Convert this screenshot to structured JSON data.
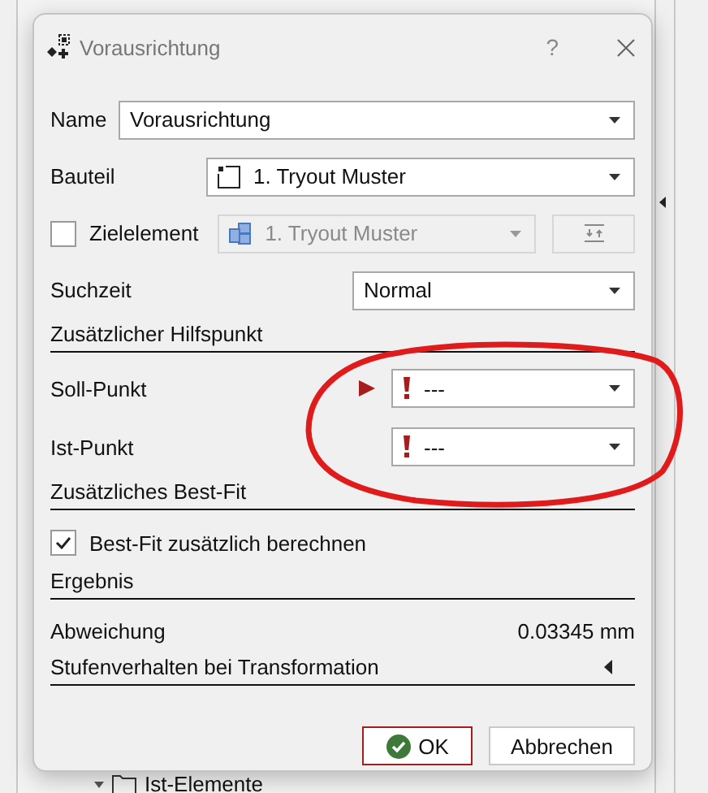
{
  "background": {
    "tree_item": "Ist-Elemente"
  },
  "window": {
    "title": "Vorausrichtung",
    "help": "?"
  },
  "rows": [
    {
      "kind": "combo",
      "label": "Name",
      "value": "Vorausrichtung"
    },
    {
      "kind": "combo",
      "label": "Bauteil",
      "value": "1. Tryout Muster"
    },
    {
      "kind": "check-combo",
      "label": "Zielelement",
      "checked": false,
      "value": "1. Tryout Muster",
      "disabled": true
    },
    {
      "kind": "combo",
      "label": "Suchzeit",
      "value": "Normal"
    },
    {
      "kind": "section",
      "label": "Zusätzlicher Hilfspunkt"
    },
    {
      "kind": "point",
      "label": "Soll-Punkt",
      "value": "---",
      "error": true,
      "active": true
    },
    {
      "kind": "point",
      "label": "Ist-Punkt",
      "value": "---",
      "error": true,
      "active": false
    },
    {
      "kind": "section",
      "label": "Zusätzliches Best-Fit"
    },
    {
      "kind": "checkbox",
      "label": "Best-Fit zusätzlich berechnen",
      "checked": true
    },
    {
      "kind": "section",
      "label": "Ergebnis"
    },
    {
      "kind": "value",
      "label": "Abweichung",
      "value": "0.03345 mm"
    },
    {
      "kind": "section",
      "label": "Stufenverhalten bei Transformation",
      "expanded": false
    }
  ],
  "buttons": [
    {
      "label": "OK",
      "default": true
    },
    {
      "label": "Abbrechen",
      "default": false
    }
  ],
  "annotations": [
    {
      "kind": "ellipse"
    }
  ]
}
